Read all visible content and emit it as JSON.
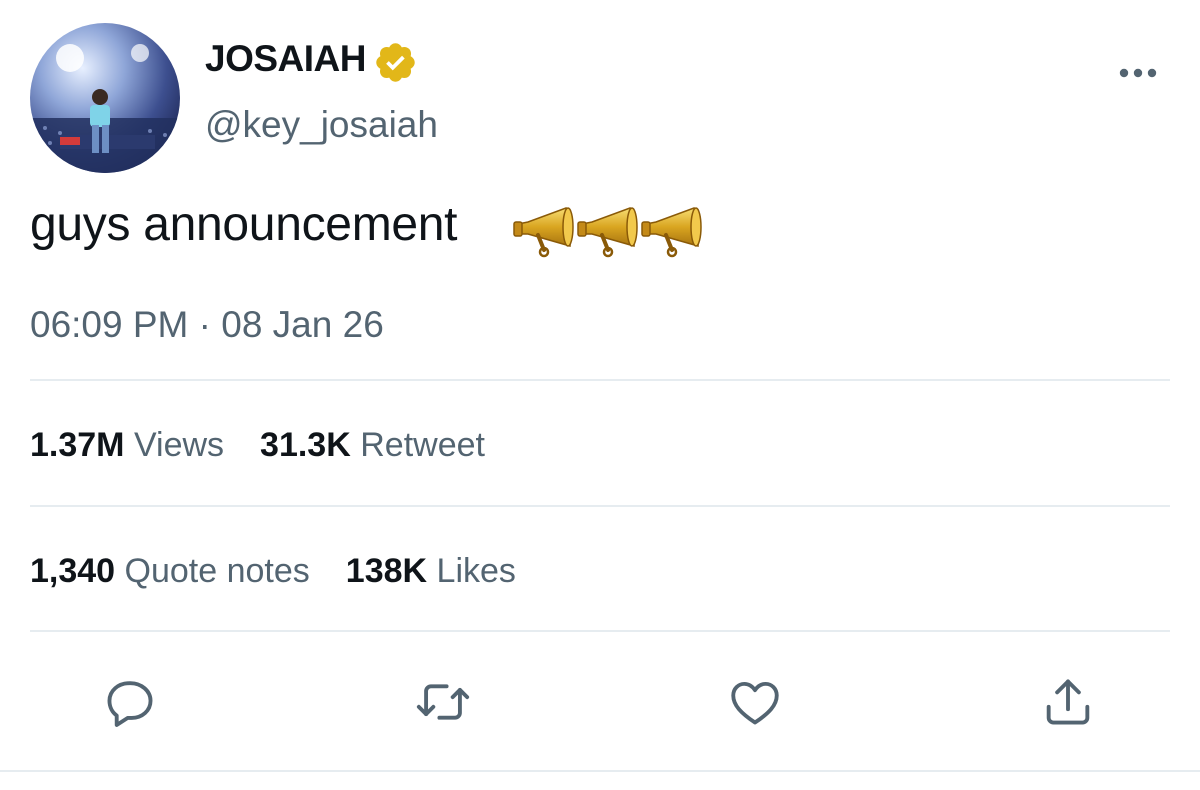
{
  "author": {
    "display_name": "JOSAIAH",
    "handle": "@key_josaiah",
    "verified_badge_icon": "verified-badge-icon",
    "badge_color": "#E2B719"
  },
  "tweet": {
    "text": "guys announcement",
    "emoji_icons": [
      "megaphone-icon",
      "megaphone-icon",
      "megaphone-icon"
    ],
    "timestamp": "06:09 PM · 08 Jan 26"
  },
  "stats_row1": {
    "views_count": "1.37M",
    "views_label": "Views",
    "retweet_count": "31.3K",
    "retweet_label": "Retweet"
  },
  "stats_row2": {
    "quote_count": "1,340",
    "quote_label": "Quote notes",
    "likes_count": "138K",
    "likes_label": "Likes"
  },
  "actions": [
    "reply-icon",
    "retweet-icon",
    "like-icon",
    "share-icon"
  ],
  "colors": {
    "text_primary": "#0f1419",
    "text_secondary": "#536471",
    "divider": "#e6ecf0",
    "icon": "#536471"
  }
}
